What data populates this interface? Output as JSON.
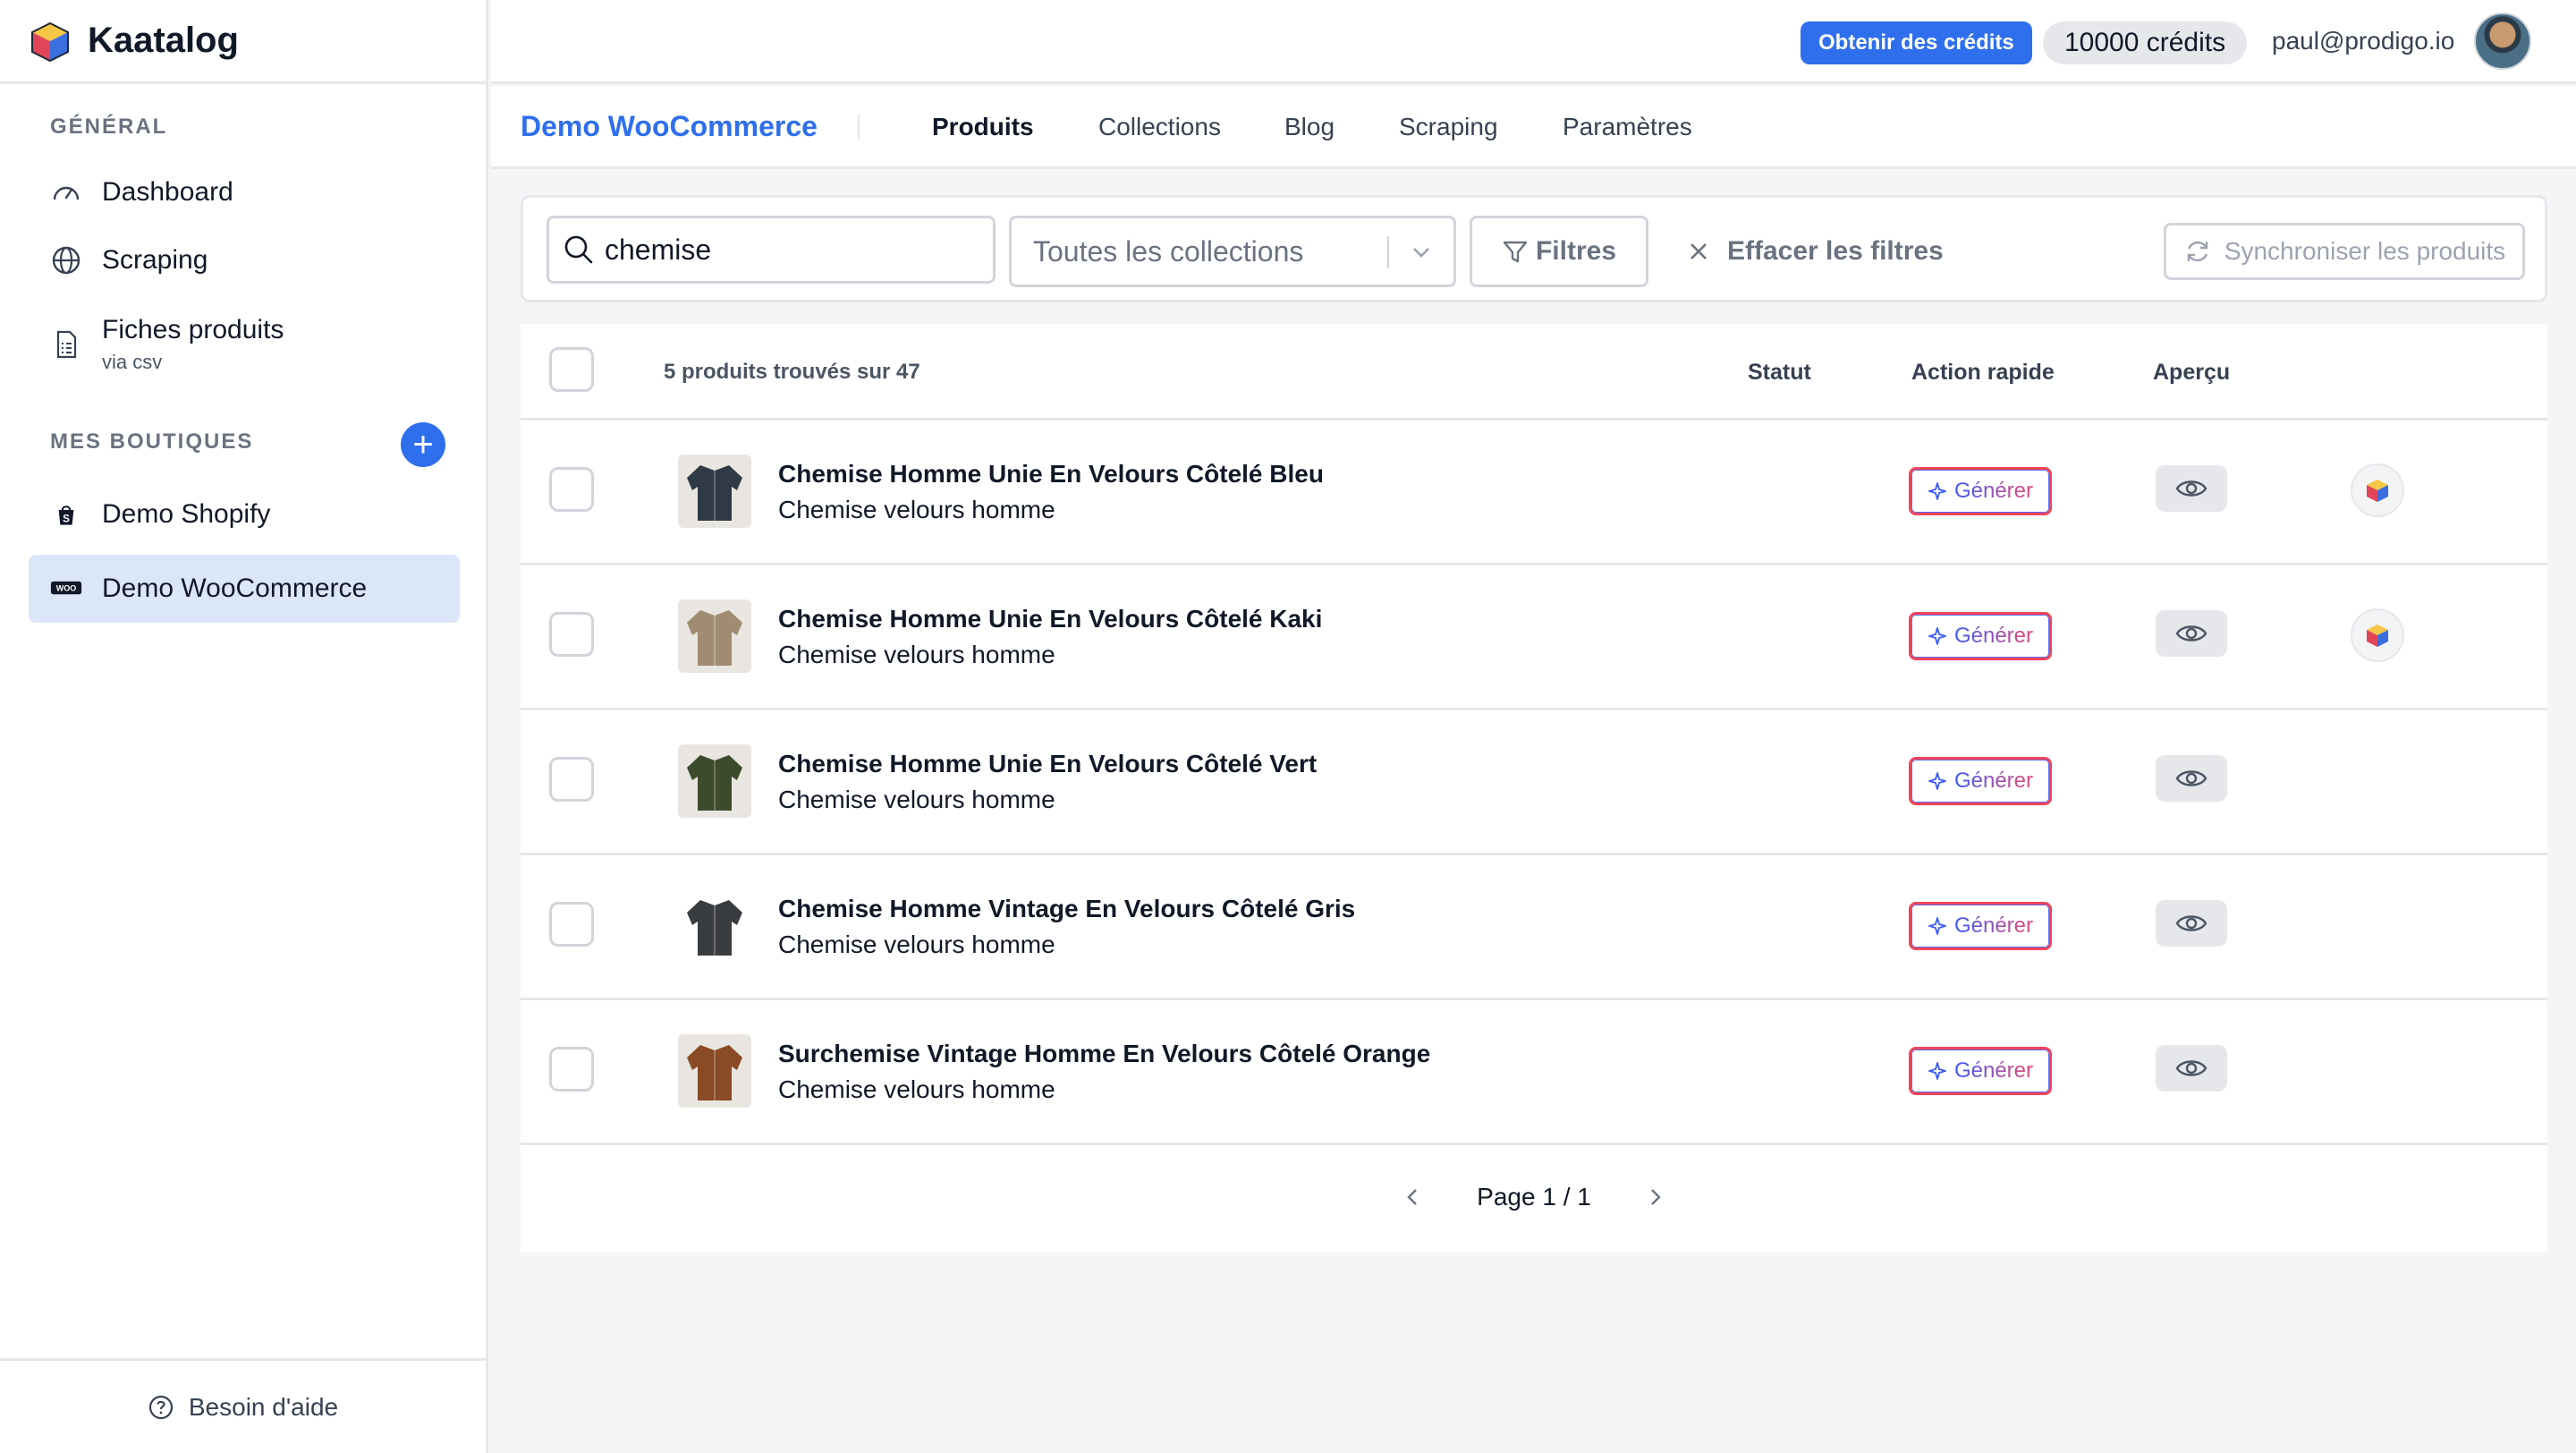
{
  "app": {
    "name": "Kaatalog"
  },
  "sidebar": {
    "general_title": "GÉNÉRAL",
    "items": [
      {
        "label": "Dashboard",
        "icon": "gauge-icon"
      },
      {
        "label": "Scraping",
        "icon": "globe-icon"
      },
      {
        "label": "Fiches produits",
        "sub": "via csv",
        "icon": "document-icon"
      }
    ],
    "shops_title": "MES BOUTIQUES",
    "add_shop": "+",
    "shops": [
      {
        "label": "Demo Shopify",
        "icon": "shopify-icon"
      },
      {
        "label": "Demo WooCommerce",
        "icon": "woocommerce-icon",
        "active": true
      }
    ],
    "help_label": "Besoin d'aide"
  },
  "topbar": {
    "credits_button": "Obtenir des crédits",
    "credits_count": "10000 crédits",
    "user_email": "paul@prodigo.io"
  },
  "subnav": {
    "store_title": "Demo WooCommerce",
    "tabs": [
      "Produits",
      "Collections",
      "Blog",
      "Scraping",
      "Paramètres"
    ],
    "active_tab": "Produits"
  },
  "filters": {
    "search_value": "chemise",
    "collection_select": "Toutes les collections",
    "filters_label": "Filtres",
    "clear_label": "Effacer les filtres",
    "sync_label": "Synchroniser les produits"
  },
  "table": {
    "count_label": "5 produits trouvés sur 47",
    "columns": {
      "status": "Statut",
      "quick_action": "Action rapide",
      "preview": "Aperçu"
    },
    "generate_label": "Générer",
    "rows": [
      {
        "title": "Chemise Homme Unie En Velours Côtelé Bleu",
        "subtitle": "Chemise velours homme",
        "color": "#2f3a44",
        "has_cube": true
      },
      {
        "title": "Chemise Homme Unie En Velours Côtelé Kaki",
        "subtitle": "Chemise velours homme",
        "color": "#a08c72",
        "has_cube": true
      },
      {
        "title": "Chemise Homme Unie En Velours Côtelé Vert",
        "subtitle": "Chemise velours homme",
        "color": "#3d4a2c",
        "has_cube": false
      },
      {
        "title": "Chemise Homme Vintage En Velours Côtelé Gris",
        "subtitle": "Chemise velours homme",
        "color": "#3a3d40",
        "has_cube": false
      },
      {
        "title": "Surchemise Vintage Homme En Velours Côtelé Orange",
        "subtitle": "Chemise velours homme",
        "color": "#8a4a26",
        "has_cube": false
      }
    ]
  },
  "pagination": {
    "label": "Page 1 / 1"
  },
  "colors": {
    "accent": "#2f6fed",
    "active_bg": "#dbe7f8",
    "generate_gradient_start": "#3b5bf6",
    "generate_gradient_end": "#e64a78"
  }
}
